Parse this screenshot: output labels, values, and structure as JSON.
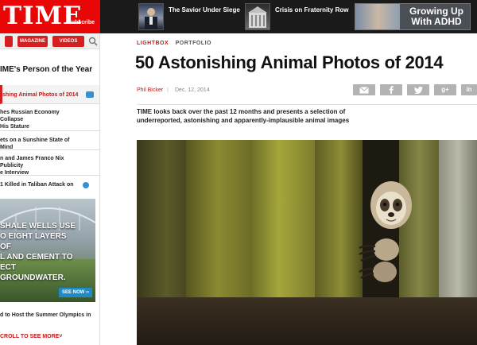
{
  "site": {
    "logo": "TIME",
    "subscribe": "Subscribe"
  },
  "topbar": {
    "promos": [
      {
        "text": "The Savior Under Siege"
      },
      {
        "text": "Crisis on Fraternity Row"
      }
    ],
    "ad": {
      "text": "Growing Up With ADHD"
    }
  },
  "sidebar": {
    "nav": {
      "magazine": "MAGAZINE",
      "videos": "VIDEOS"
    },
    "poy": "IME's Person of the Year",
    "stories": [
      {
        "text": "shing Animal Photos of 2014",
        "active": true
      },
      {
        "text": "hes Russian Economy Collapse\n His Stature",
        "active": false
      },
      {
        "text": "ets on a Sunshine State of Mind",
        "active": false
      },
      {
        "text": "n and James Franco Nix Publicity\ne Interview",
        "active": false
      },
      {
        "text": "1 Killed in Taliban Attack on",
        "active": false
      }
    ],
    "ad": {
      "text": "SHALE WELLS USE\nO EIGHT LAYERS OF\nL AND CEMENT TO\nECT GROUNDWATER.",
      "cta": "SEE NOW ››"
    },
    "summer": "d to Host the Summer Olympics in",
    "scroll_more": "CROLL TO SEE MORE˅"
  },
  "article": {
    "kicker": [
      "LIGHTBOX",
      "PORTFOLIO"
    ],
    "headline": "50 Astonishing Animal Photos of 2014",
    "author": "Phil Bicker",
    "separator": "|",
    "date": "Dec. 12, 2014",
    "share": {
      "google": "g+",
      "linkedin": "in"
    },
    "lede": "TIME looks back over the past 12 months and presents a selection of underreported, astonishing and apparently-implausible animal images"
  },
  "colors": {
    "brand_red": "#e90606",
    "link_red": "#c41a1a",
    "share_gray": "#b3b3b3",
    "accent_blue": "#1e8bc9"
  }
}
